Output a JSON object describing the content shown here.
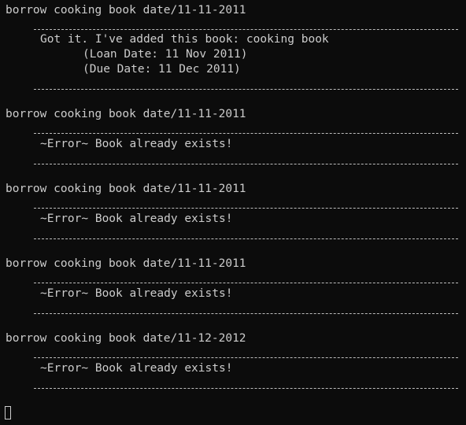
{
  "terminal": {
    "blocks": [
      {
        "command": "borrow cooking book date/11-11-2011",
        "response": [
          "Got it. I've added this book: cooking book",
          "(Loan Date: 11 Nov 2011)",
          "(Due Date: 11 Dec 2011)"
        ]
      },
      {
        "command": "borrow cooking book date/11-11-2011",
        "response": [
          "~Error~ Book already exists!"
        ]
      },
      {
        "command": "borrow cooking book date/11-11-2011",
        "response": [
          "~Error~ Book already exists!"
        ]
      },
      {
        "command": "borrow cooking book date/11-11-2011",
        "response": [
          "~Error~ Book already exists!"
        ]
      },
      {
        "command": "borrow cooking book date/11-12-2012",
        "response": [
          "~Error~ Book already exists!"
        ]
      }
    ],
    "colors": {
      "background": "#0c0c0c",
      "text": "#cccccc"
    }
  }
}
